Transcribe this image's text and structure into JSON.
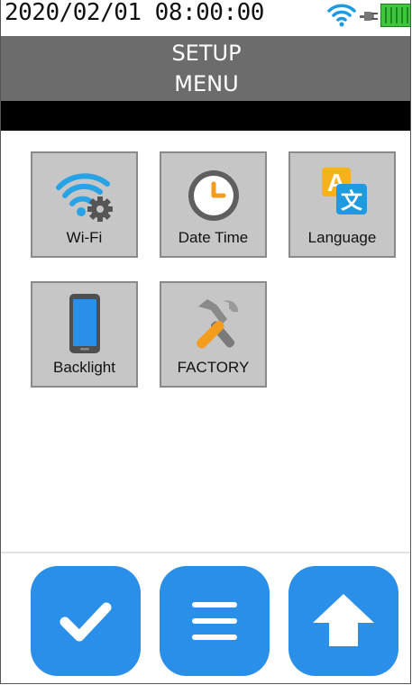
{
  "status_bar": {
    "datetime": "2020/02/01 08:00:00",
    "icons": [
      "wifi-icon",
      "plug-icon",
      "battery-icon"
    ]
  },
  "title": {
    "line1": "SETUP",
    "line2": "MENU"
  },
  "menu": {
    "items": [
      {
        "label": "Wi-Fi",
        "icon": "wifi-settings-icon"
      },
      {
        "label": "Date Time",
        "icon": "clock-icon"
      },
      {
        "label": "Language",
        "icon": "language-icon"
      },
      {
        "label": "Backlight",
        "icon": "phone-icon"
      },
      {
        "label": "FACTORY",
        "icon": "tools-icon"
      }
    ]
  },
  "bottom_bar": {
    "buttons": [
      {
        "name": "confirm",
        "icon": "check-icon"
      },
      {
        "name": "menu",
        "icon": "menu-icon"
      },
      {
        "name": "up",
        "icon": "arrow-up-icon"
      }
    ]
  },
  "colors": {
    "title_bg": "#6c6c6c",
    "tile_bg": "#c6c6c6",
    "button_blue": "#2a8fe8",
    "battery_green": "#3ec63e"
  }
}
